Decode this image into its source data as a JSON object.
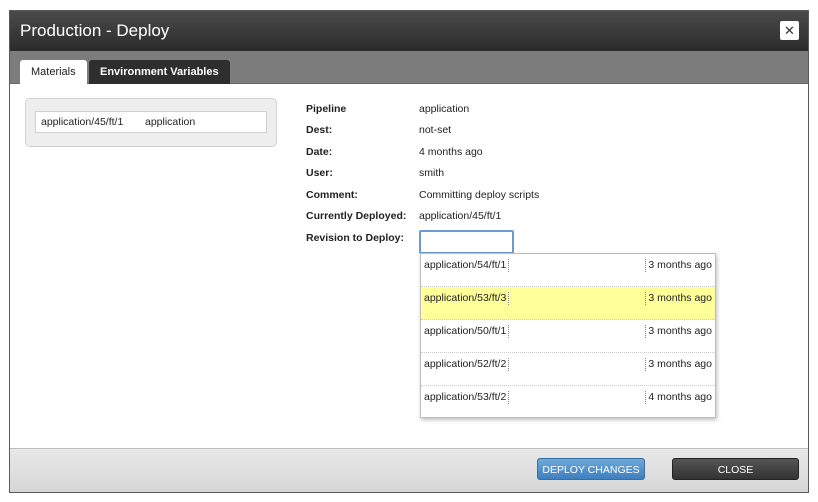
{
  "dialog": {
    "title": "Production - Deploy",
    "close_symbol": "✕"
  },
  "tabs": [
    {
      "label": "Materials",
      "active": true
    },
    {
      "label": "Environment Variables",
      "active": false
    }
  ],
  "materials": [
    {
      "revision": "application/45/ft/1",
      "name": "application"
    }
  ],
  "details": {
    "pipeline_label": "Pipeline",
    "pipeline_value": "application",
    "dest_label": "Dest:",
    "dest_value": "not-set",
    "date_label": "Date:",
    "date_value": "4 months ago",
    "user_label": "User:",
    "user_value": "smith",
    "comment_label": "Comment:",
    "comment_value": "Committing deploy scripts",
    "currently_deployed_label": "Currently Deployed:",
    "currently_deployed_value": "application/45/ft/1",
    "revision_label": "Revision to Deploy:",
    "revision_input_value": ""
  },
  "revision_options": [
    {
      "revision": "application/54/ft/1",
      "time": "3 months ago",
      "highlighted": false
    },
    {
      "revision": "application/53/ft/3",
      "time": "3 months ago",
      "highlighted": true
    },
    {
      "revision": "application/50/ft/1",
      "time": "3 months ago",
      "highlighted": false
    },
    {
      "revision": "application/52/ft/2",
      "time": "3 months ago",
      "highlighted": false
    },
    {
      "revision": "application/53/ft/2",
      "time": "4 months ago",
      "highlighted": false
    }
  ],
  "footer": {
    "deploy_label": "DEPLOY CHANGES",
    "close_label": "CLOSE"
  },
  "colors": {
    "titlebar": "#333333",
    "highlight": "#ffff99",
    "primary_button": "#4f8fcc",
    "secondary_button": "#444444"
  }
}
